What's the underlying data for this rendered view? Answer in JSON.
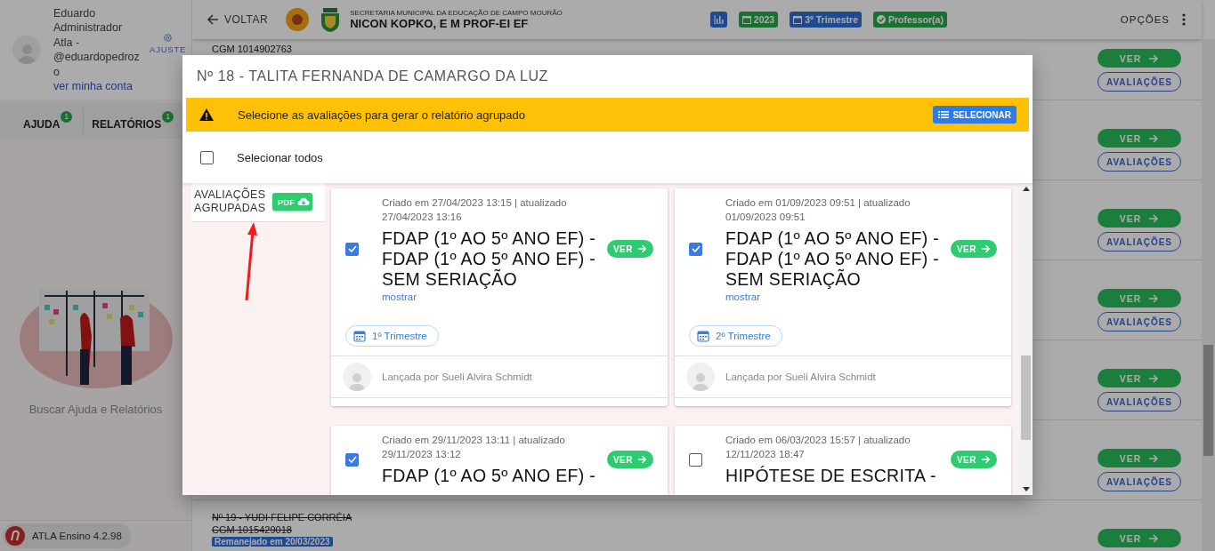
{
  "sidebar": {
    "user_name": "Eduardo Administrador Atla - @eduardopedrozo",
    "account_link": "ver minha conta",
    "settings": "AJUSTE",
    "tabs": [
      {
        "label": "AJUDA",
        "count": "1",
        "selected": false
      },
      {
        "label": "RELATÓRIOS",
        "count": "1",
        "selected": false
      }
    ],
    "help_caption": "Buscar Ajuda e Relatórios",
    "version": "ATLA Ensino 4.2.98"
  },
  "header": {
    "back": "VOLTAR",
    "subtitle": "SECRETARIA MUNICIPAL DA EDUCAÇÃO DE CAMPO MOURÃO",
    "school": "NICON KOPKO, E M PROF-EI EF",
    "chips": [
      {
        "kind": "chart"
      },
      {
        "kind": "year",
        "label": "2023"
      },
      {
        "kind": "term",
        "label": "3º Trimestre"
      },
      {
        "kind": "role",
        "label": "Professor(a)"
      }
    ],
    "options": "OPÇÕES"
  },
  "students": [
    {
      "lines": [
        {
          "kind": "cgm",
          "text": "CGM 1014902763",
          "struck": false
        }
      ],
      "view": "VER",
      "evaluations": "AVALIAÇÕES"
    },
    {
      "view": "VER",
      "evaluations": "AVALIAÇÕES"
    },
    {
      "view": "VER",
      "evaluations": "AVALIAÇÕES"
    },
    {
      "view": "VER",
      "evaluations": "AVALIAÇÕES"
    },
    {
      "view": "VER",
      "evaluations": "AVALIAÇÕES"
    },
    {
      "view": "VER",
      "evaluations": "AVALIAÇÕES"
    },
    {
      "lines": [
        {
          "kind": "name",
          "text": "Nº 19 - YUDI FELIPE CORRÊIA",
          "struck": true
        },
        {
          "kind": "cgm",
          "text": "CGM 1015429018",
          "struck": true
        },
        {
          "kind": "badge",
          "text": "Remanejado em 20/03/2023"
        }
      ],
      "view": "VER"
    }
  ],
  "modal": {
    "title": "Nº 18 - TALITA FERNANDA DE CAMARGO DA LUZ",
    "warning": {
      "text": "Selecione as avaliações para gerar o relatório agrupado",
      "button": "SELECIONAR"
    },
    "select_all": {
      "label": "Selecionar todos",
      "checked": false
    },
    "grouped": {
      "label": "AVALIAÇÕES AGRUPADAS",
      "button": "PDF"
    },
    "cards": [
      {
        "checked": true,
        "created": "Criado em 27/04/2023 13:15 | atualizado 27/04/2023 13:16",
        "title": "FDAP (1º AO 5º ANO EF) - FDAP (1º AO 5º ANO EF) - SEM SERIAÇÃO",
        "more": "mostrar",
        "view": "VER",
        "term": "1º Trimestre",
        "author": "Lançada por Sueli Alvira Schmidt"
      },
      {
        "checked": true,
        "created": "Criado em 01/09/2023 09:51 | atualizado 01/09/2023 09:51",
        "title": "FDAP (1º AO 5º ANO EF) - FDAP (1º AO 5º ANO EF) - SEM SERIAÇÃO",
        "more": "mostrar",
        "view": "VER",
        "term": "2º Trimestre",
        "author": "Lançada por Sueli Alvira Schmidt"
      },
      {
        "checked": true,
        "created": "Criado em 29/11/2023 13:11 | atualizado 29/11/2023 13:12",
        "title": "FDAP (1º AO 5º ANO EF) -",
        "view": "VER"
      },
      {
        "checked": false,
        "created": "Criado em 06/03/2023 15:57 | atualizado 12/11/2023 18:47",
        "title": "HIPÓTESE DE ESCRITA -",
        "view": "VER"
      }
    ]
  }
}
